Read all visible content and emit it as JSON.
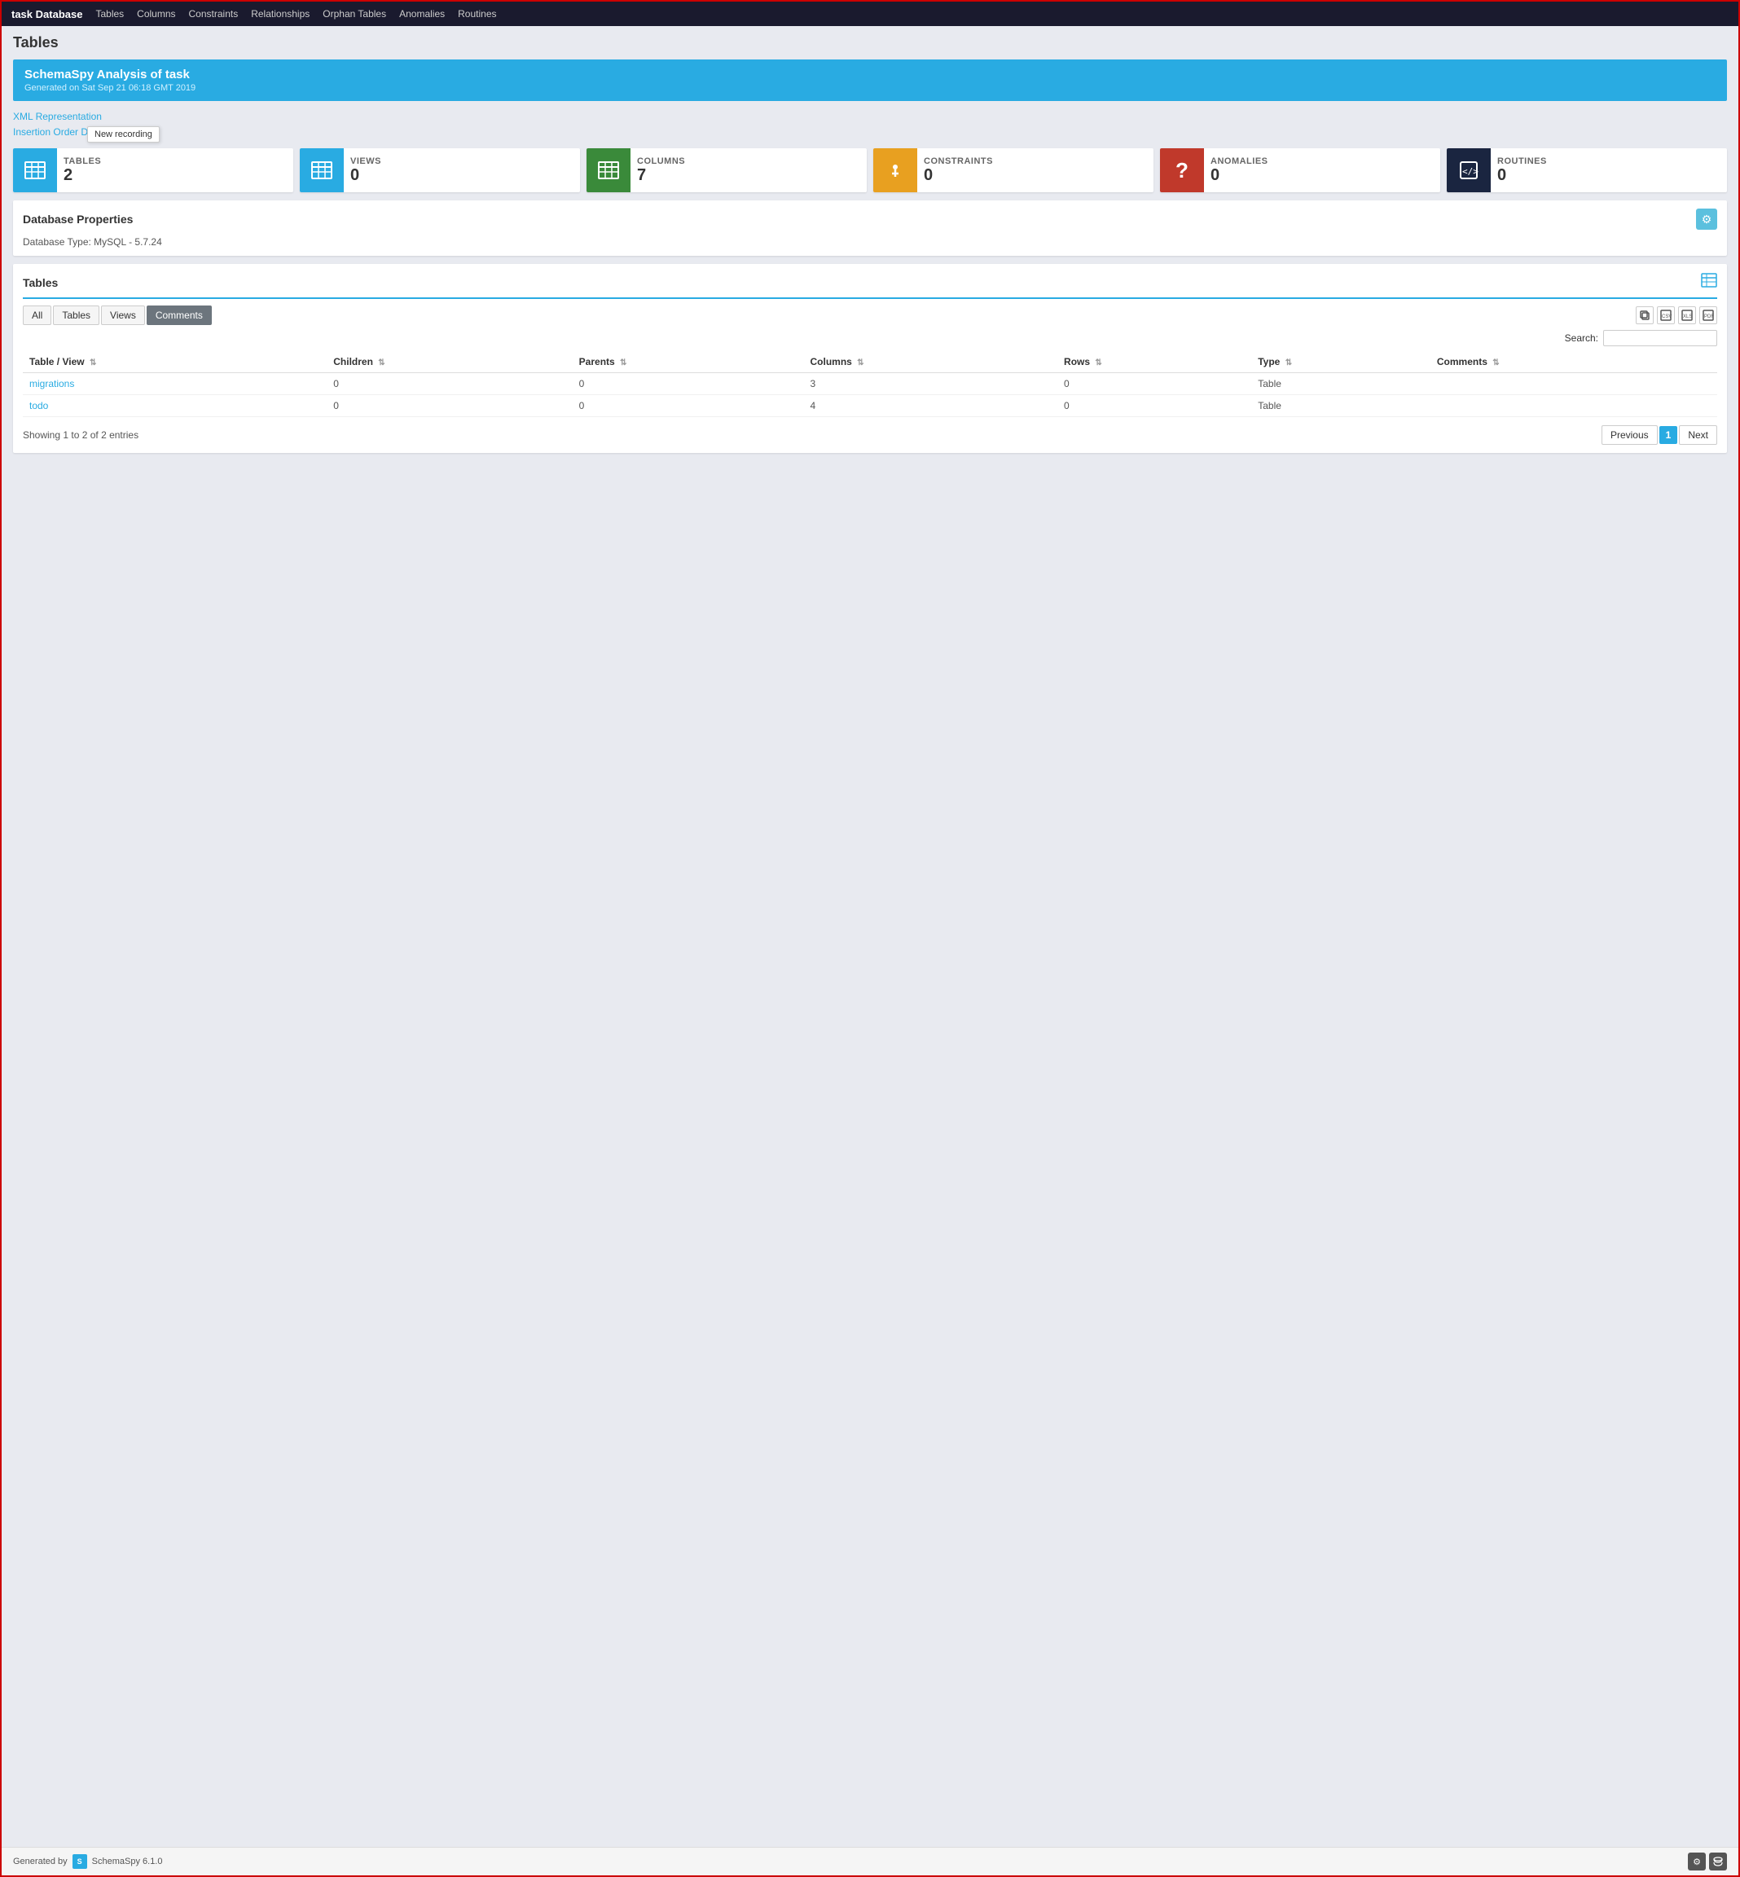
{
  "navbar": {
    "brand_plain": "task",
    "brand_bold": "Database",
    "links": [
      {
        "label": "Tables",
        "href": "#"
      },
      {
        "label": "Columns",
        "href": "#"
      },
      {
        "label": "Constraints",
        "href": "#"
      },
      {
        "label": "Relationships",
        "href": "#"
      },
      {
        "label": "Orphan Tables",
        "href": "#"
      },
      {
        "label": "Anomalies",
        "href": "#"
      },
      {
        "label": "Routines",
        "href": "#"
      }
    ]
  },
  "page_title": "Tables",
  "banner": {
    "title": "SchemaSpy Analysis of task",
    "subtitle": "Generated on Sat Sep 21 06:18 GMT 2019"
  },
  "links": [
    {
      "label": "XML Representation",
      "href": "#"
    },
    {
      "label": "Insertion Order Deletion Order",
      "href": "#"
    }
  ],
  "stat_cards": [
    {
      "label": "TABLES",
      "value": "2",
      "color": "#29abe2",
      "icon": "⊞"
    },
    {
      "label": "VIEWS",
      "value": "0",
      "color": "#29abe2",
      "icon": "⊞"
    },
    {
      "label": "COLUMNS",
      "value": "7",
      "color": "#3a8a3a",
      "icon": "⊟"
    },
    {
      "label": "CONSTRAINTS",
      "value": "0",
      "color": "#e8a020",
      "icon": "⚙"
    },
    {
      "label": "ANOMALIES",
      "value": "0",
      "color": "#c0392b",
      "icon": "?"
    },
    {
      "label": "ROUTINES",
      "value": "0",
      "color": "#1a2540",
      "icon": "</>"
    }
  ],
  "db_properties": {
    "title": "Database Properties",
    "db_type_label": "Database Type: MySQL - 5.7.24"
  },
  "tables_section": {
    "title": "Tables",
    "tabs": [
      "All",
      "Tables",
      "Views",
      "Comments"
    ],
    "active_tab": "Comments",
    "search_label": "Search:",
    "search_placeholder": "",
    "columns": [
      {
        "label": "Table / View",
        "sort": true
      },
      {
        "label": "Children",
        "sort": true
      },
      {
        "label": "Parents",
        "sort": true
      },
      {
        "label": "Columns",
        "sort": true
      },
      {
        "label": "Rows",
        "sort": true
      },
      {
        "label": "Type",
        "sort": true
      },
      {
        "label": "Comments",
        "sort": true
      }
    ],
    "rows": [
      {
        "name": "migrations",
        "href": "#",
        "children": "0",
        "parents": "0",
        "columns": "3",
        "rows": "0",
        "type": "Table",
        "comments": ""
      },
      {
        "name": "todo",
        "href": "#",
        "children": "0",
        "parents": "0",
        "columns": "4",
        "rows": "0",
        "type": "Table",
        "comments": ""
      }
    ],
    "pagination": {
      "info": "Showing 1 to 2 of 2 entries",
      "prev_label": "Previous",
      "current_page": "1",
      "next_label": "Next"
    }
  },
  "tooltip": "New recording",
  "footer": {
    "generated_by": "Generated by",
    "brand": "SchemaSpy 6.1.0"
  }
}
